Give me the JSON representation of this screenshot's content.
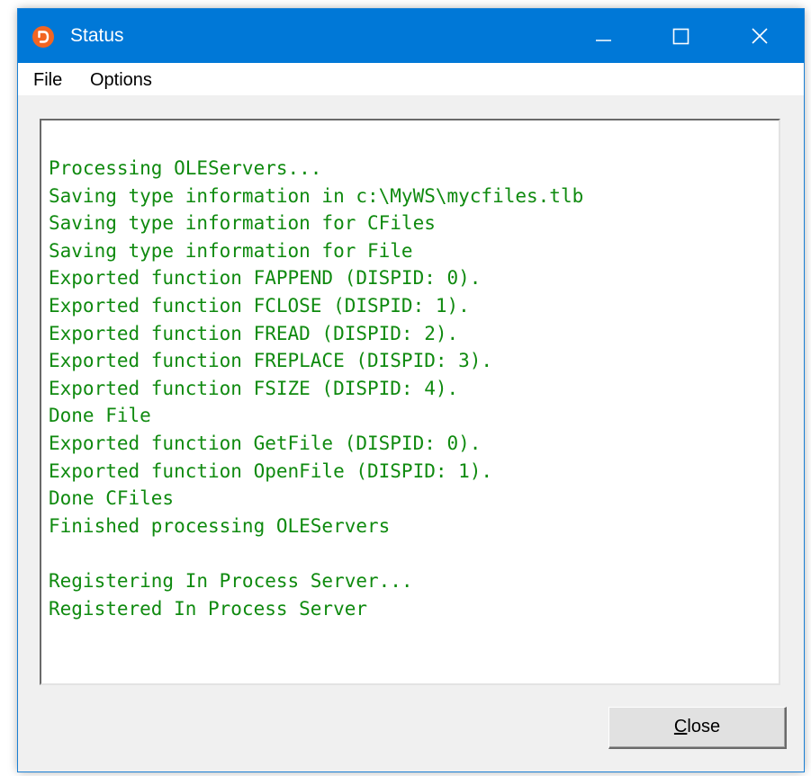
{
  "window": {
    "title": "Status",
    "app_icon": "app-logo-icon",
    "controls": [
      "minimize-icon",
      "maximize-icon",
      "close-icon"
    ],
    "colors": {
      "titlebar": "#0078d7",
      "output_text": "#0f8a0f",
      "app_icon": "#f26522"
    }
  },
  "menu": {
    "items": [
      {
        "label": "File"
      },
      {
        "label": "Options"
      }
    ]
  },
  "output": {
    "lines": [
      "Processing OLEServers...",
      "Saving type information in c:\\MyWS\\mycfiles.tlb",
      "Saving type information for CFiles",
      "Saving type information for File",
      "Exported function FAPPEND (DISPID: 0).",
      "Exported function FCLOSE (DISPID: 1).",
      "Exported function FREAD (DISPID: 2).",
      "Exported function FREPLACE (DISPID: 3).",
      "Exported function FSIZE (DISPID: 4).",
      "Done File",
      "Exported function GetFile (DISPID: 0).",
      "Exported function OpenFile (DISPID: 1).",
      "Done CFiles",
      "Finished processing OLEServers",
      "",
      "Registering In Process Server...",
      "Registered In Process Server"
    ]
  },
  "buttons": {
    "close": {
      "mnemonic": "C",
      "rest": "lose"
    }
  }
}
